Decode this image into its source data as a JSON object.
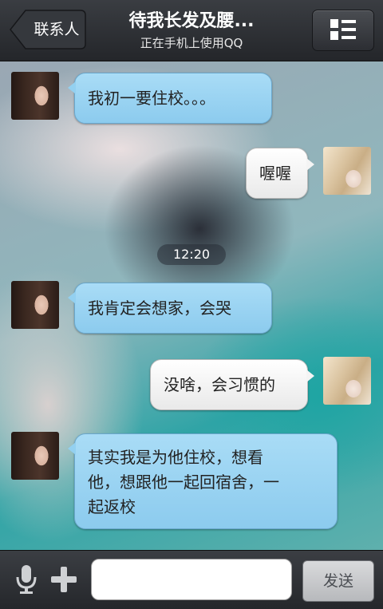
{
  "header": {
    "back_label": "联系人",
    "title": "待我长发及腰...",
    "subtitle": "正在手机上使用QQ"
  },
  "messages": [
    {
      "side": "left",
      "text": "我初一要住校。。。"
    },
    {
      "side": "right",
      "text": "喔喔"
    },
    {
      "side": "time",
      "text": "12:20"
    },
    {
      "side": "left",
      "text": "我肯定会想家，会哭"
    },
    {
      "side": "right",
      "text": "没啥，会习惯的"
    },
    {
      "side": "left",
      "lines": [
        "其实我是为他住校，想看",
        "他，想跟他一起回宿舍，一",
        "起返校"
      ]
    }
  ],
  "footer": {
    "input_value": "",
    "send_label": "发送"
  },
  "icons": {
    "back": "back-arrow-icon",
    "menu": "menu-list-icon",
    "mic": "microphone-icon",
    "plus": "plus-icon"
  },
  "colors": {
    "header_bg": "#2e3035",
    "incoming_bubble": "#9dd5f3",
    "outgoing_bubble": "#f2f2f2",
    "send_button": "#c9cacc"
  }
}
